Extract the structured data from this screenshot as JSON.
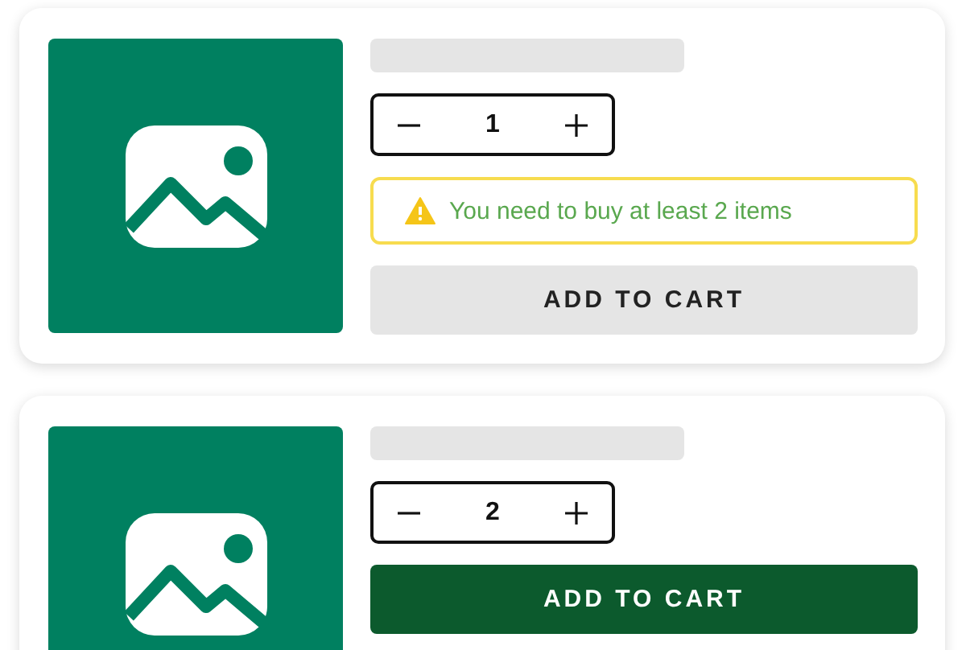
{
  "cards": [
    {
      "quantity": "1",
      "warning": {
        "text": "You need to buy at least 2 items"
      },
      "button": {
        "label": "ADD TO CART",
        "disabled": true
      }
    },
    {
      "quantity": "2",
      "button": {
        "label": "ADD TO CART",
        "disabled": false
      }
    }
  ]
}
